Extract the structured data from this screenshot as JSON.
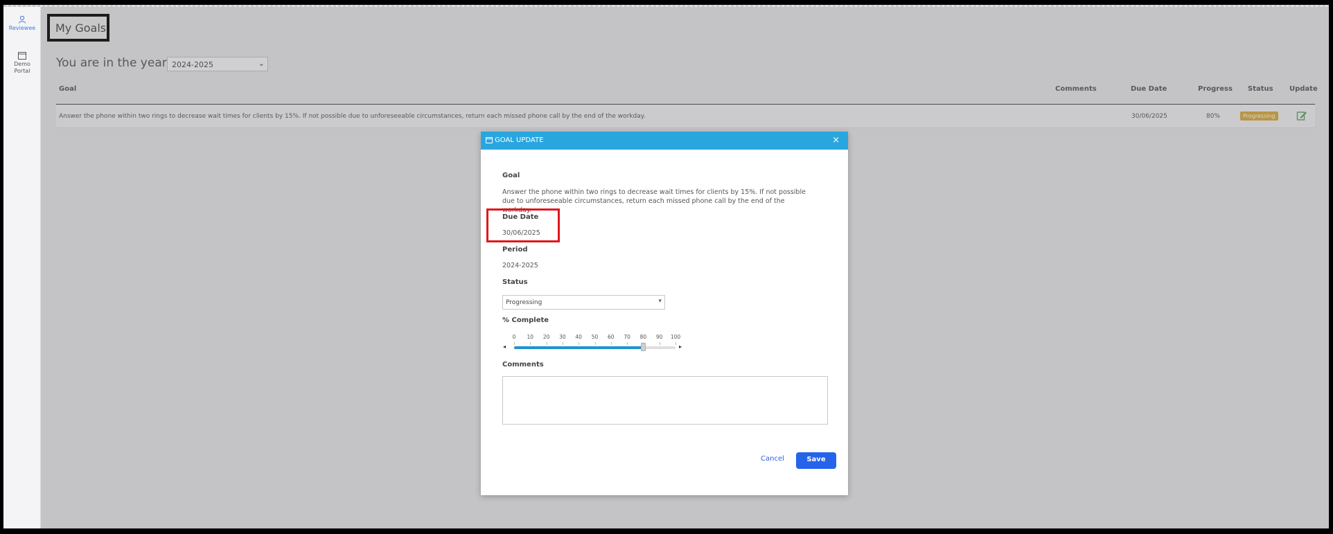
{
  "sidebar": {
    "items": [
      {
        "label": "Reviewee",
        "icon": "user-icon",
        "active": true
      },
      {
        "label": "Demo Portal",
        "icon": "window-icon",
        "active": false
      }
    ]
  },
  "page": {
    "title": "My Goals",
    "year_label": "You are in the year",
    "year_value": "2024-2025"
  },
  "table": {
    "headers": {
      "goal": "Goal",
      "comments": "Comments",
      "due_date": "Due Date",
      "progress": "Progress",
      "status": "Status",
      "update": "Update"
    },
    "rows": [
      {
        "goal": "Answer the phone within two rings to decrease wait times for clients by 15%. If not possible due to unforeseeable circumstances, return each missed phone call by the end of the workday.",
        "comments": "",
        "due_date": "30/06/2025",
        "progress": "80%",
        "status": "Progressing"
      }
    ]
  },
  "modal": {
    "title": "GOAL UPDATE",
    "goal_label": "Goal",
    "goal_text": "Answer the phone within two rings to decrease wait times for clients by 15%. If not possible due to unforeseeable circumstances, return each missed phone call by the end of the workday.",
    "due_date_label": "Due Date",
    "due_date_value": "30/06/2025",
    "period_label": "Period",
    "period_value": "2024-2025",
    "status_label": "Status",
    "status_value": "Progressing",
    "complete_label": "% Complete",
    "complete_ticks": [
      "0",
      "10",
      "20",
      "30",
      "40",
      "50",
      "60",
      "70",
      "80",
      "90",
      "100"
    ],
    "complete_value": 80,
    "comments_label": "Comments",
    "comments_value": "",
    "cancel_label": "Cancel",
    "save_label": "Save"
  },
  "colors": {
    "header_blue": "#2aa6df",
    "save_blue": "#2563eb",
    "status_badge": "#d8a93a",
    "highlight_red": "#e0161c"
  }
}
